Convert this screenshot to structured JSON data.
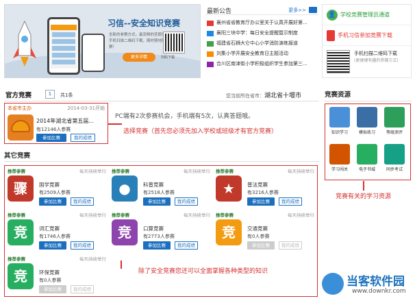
{
  "banner": {
    "title": "习信--安全知识竞赛",
    "subtitle": "全新的参赛方式，最流畅的答题体验！手机扫描二维码下载，随时随地随意参赛！",
    "button": "更多详情",
    "qr_caption": "扫码下载"
  },
  "news": {
    "title": "最新公告",
    "more": "更多>>",
    "items": [
      "襄州省省教育厅办公室关于认真开展好第...",
      "襄阳三块中学：每日安全提醒暨示制度",
      "福建省石狮大仑中心小学消防演练报道",
      "刘集小学开展安全教育日主题活动",
      "合川区南津街小学积极组织学生参加第三..."
    ],
    "icon_colors": [
      "#e53935",
      "#1e88e5",
      "#43a047",
      "#fb8c00",
      "#8e24aa"
    ]
  },
  "side": {
    "admin": "学校竞赛管理员通道",
    "download": "手机习信参加竞赛下载",
    "scan_line1": "手机扫描二维码下载",
    "scan_line2": "(更便捷有趣的参赛方式)"
  },
  "official": {
    "title": "官方竞赛",
    "page": "1",
    "count": "共1条",
    "location_prefix": "您当前所在省市：",
    "location": "湖北省十堰市",
    "card": {
      "tag": "本省市主办",
      "date": "2014-03-31开始",
      "name": "2014年湖北省第五届...",
      "participants": "有12146人参赛",
      "join": "参加比赛",
      "score": "我的成绩"
    },
    "note": "PC端有2次参赛机会，手机端有5次，认真答题哦。",
    "annotation": "选择竞赛（首先您必须先加入学校或班级才有官方竞赛）"
  },
  "other": {
    "title": "其它竞赛",
    "items": [
      {
        "rec": "推荐参赛",
        "freq": "每天持续举行",
        "name": "国学竞赛",
        "participants": "有2509人参赛",
        "join": "参加比赛",
        "score": "我的成绩",
        "active": true,
        "color": "#c0392b",
        "glyph": "骤"
      },
      {
        "rec": "推荐参赛",
        "freq": "每天持续举行",
        "name": "科普竞赛",
        "participants": "有2518人参赛",
        "join": "参加比赛",
        "score": "我的成绩",
        "active": true,
        "color": "#2980b9",
        "glyph": "●"
      },
      {
        "rec": "推荐参赛",
        "freq": "每天持续举行",
        "name": "普法竞赛",
        "participants": "有3216人参赛",
        "join": "参加比赛",
        "score": "我的成绩",
        "active": true,
        "color": "#c0392b",
        "glyph": "★"
      },
      {
        "rec": "推荐参赛",
        "freq": "每天持续举行",
        "name": "词汇竞赛",
        "participants": "有1746人参赛",
        "join": "参加比赛",
        "score": "我的成绩",
        "active": true,
        "color": "#27ae60",
        "glyph": "竞"
      },
      {
        "rec": "推荐参赛",
        "freq": "每天持续举行",
        "name": "口算竞赛",
        "participants": "有2773人参赛",
        "join": "参加比赛",
        "score": "我的成绩",
        "active": true,
        "color": "#8e44ad",
        "glyph": "竞"
      },
      {
        "rec": "推荐参赛",
        "freq": "每天持续举行",
        "name": "交通竞赛",
        "participants": "有0人参赛",
        "join": "参加比赛",
        "score": "我的成绩",
        "active": false,
        "color": "#f39c12",
        "glyph": "竞"
      },
      {
        "rec": "推荐参赛",
        "freq": "每天持续举行",
        "name": "环保竞赛",
        "participants": "有0人参赛",
        "join": "参加比赛",
        "score": "我的成绩",
        "active": false,
        "color": "#27ae60",
        "glyph": "竞"
      }
    ],
    "annotation": "除了安全竞赛您还可以全面掌握各种类型的知识"
  },
  "resources": {
    "title": "竞赛资源",
    "items": [
      {
        "label": "知识学习",
        "color": "#4a90d9"
      },
      {
        "label": "模拟练习",
        "color": "#3a6ea5"
      },
      {
        "label": "等级测评",
        "color": "#2e9e5b"
      },
      {
        "label": "学习闯关",
        "color": "#d35400"
      },
      {
        "label": "电子书城",
        "color": "#27ae60"
      },
      {
        "label": "同步考试",
        "color": "#16a085"
      }
    ],
    "annotation": "竞赛有关的学习资源"
  },
  "logo": {
    "name": "当客软件园",
    "url": "www.downkr.com"
  }
}
